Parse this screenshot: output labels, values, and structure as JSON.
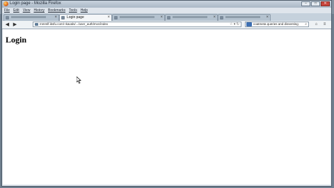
{
  "window": {
    "title": "Login page - Mozilla Firefox",
    "controls": {
      "minimize": "–",
      "maximize": "□",
      "close": "✕"
    }
  },
  "menu": [
    "File",
    "Edit",
    "View",
    "History",
    "Bookmarks",
    "Tools",
    "Help"
  ],
  "tabs": [
    {
      "label": "",
      "active": false,
      "icon": "page-icon"
    },
    {
      "label": "Login page",
      "active": true,
      "icon": "page-icon"
    },
    {
      "label": "",
      "active": false,
      "icon": "page-icon"
    },
    {
      "label": "",
      "active": false,
      "icon": "page-icon"
    },
    {
      "label": "",
      "active": false,
      "icon": "page-icon"
    }
  ],
  "navbar": {
    "back": "◀",
    "forward": "▶",
    "url": "mmmlf.iksfu.com/~kavals/.../user_auth/mvc/index",
    "url_right_icons": "☆ ▾ ↻",
    "search_text": "coatmeta queries and dissenting",
    "search_go": "⌕",
    "right_icons": [
      "home-icon",
      "menu-icon"
    ]
  },
  "page": {
    "heading": "Login"
  },
  "colors": {
    "window_frame": "#dfe5ec",
    "page_bg": "#ffffff",
    "heading": "#000000"
  }
}
